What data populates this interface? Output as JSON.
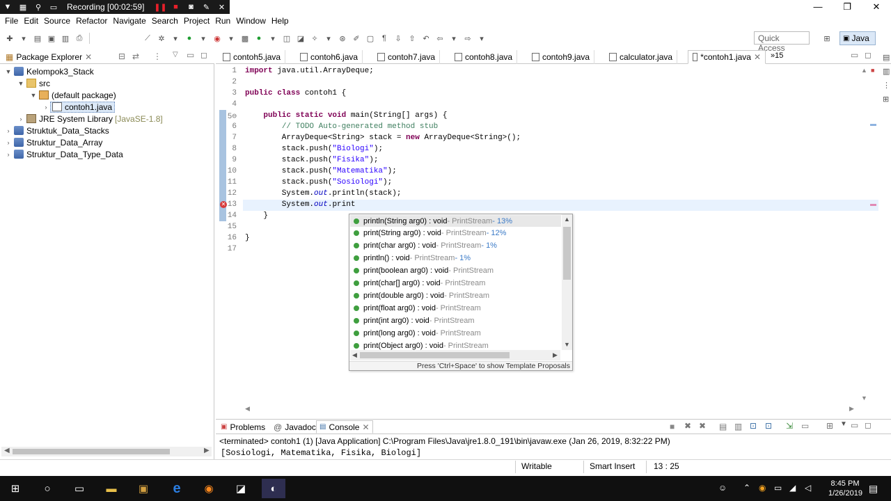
{
  "recording": {
    "label": "Recording [00:02:59]"
  },
  "window": {
    "minimize": "—",
    "maximize": "❐",
    "close": "✕"
  },
  "menu": [
    "File",
    "Edit",
    "Source",
    "Refactor",
    "Navigate",
    "Search",
    "Project",
    "Run",
    "Window",
    "Help"
  ],
  "toolbar": {
    "quick_access_placeholder": "Quick Access",
    "perspective": "Java"
  },
  "package_explorer": {
    "title": "Package Explorer",
    "tree": [
      {
        "label": "Kelompok3_Stack",
        "expanded": true
      },
      {
        "label": "src",
        "expanded": true
      },
      {
        "label": "(default package)",
        "expanded": true
      },
      {
        "label": "contoh1.java",
        "expanded": false
      },
      {
        "label": "JRE System Library",
        "suffix": "[JavaSE-1.8]",
        "expanded": false
      },
      {
        "label": "Struktuk_Data_Stacks",
        "expanded": false
      },
      {
        "label": "Struktur_Data_Array",
        "expanded": false
      },
      {
        "label": "Struktur_Data_Type_Data",
        "expanded": false
      }
    ]
  },
  "editor": {
    "tabs": [
      "contoh5.java",
      "contoh6.java",
      "contoh7.java",
      "contoh8.java",
      "contoh9.java",
      "calculator.java",
      "*contoh1.java"
    ],
    "overflow": "»15",
    "line_numbers": [
      "1",
      "2",
      "3",
      "4",
      "5⊖",
      "6",
      "7",
      "8",
      "9",
      "10",
      "11",
      "12",
      "13",
      "14",
      "15",
      "16",
      "17"
    ],
    "cursor": "13 : 25"
  },
  "content_assist": {
    "proposals": [
      {
        "sig": "println(String arg0) : void",
        "type": " - PrintStream",
        "pct": " - 13%"
      },
      {
        "sig": "print(String arg0) : void",
        "type": " - PrintStream",
        "pct": " - 12%"
      },
      {
        "sig": "print(char arg0) : void",
        "type": " - PrintStream",
        "pct": " - 1%"
      },
      {
        "sig": "println() : void",
        "type": " - PrintStream",
        "pct": " - 1%"
      },
      {
        "sig": "print(boolean arg0) : void",
        "type": " - PrintStream",
        "pct": ""
      },
      {
        "sig": "print(char[] arg0) : void",
        "type": " - PrintStream",
        "pct": ""
      },
      {
        "sig": "print(double arg0) : void",
        "type": " - PrintStream",
        "pct": ""
      },
      {
        "sig": "print(float arg0) : void",
        "type": " - PrintStream",
        "pct": ""
      },
      {
        "sig": "print(int arg0) : void",
        "type": " - PrintStream",
        "pct": ""
      },
      {
        "sig": "print(long arg0) : void",
        "type": " - PrintStream",
        "pct": ""
      },
      {
        "sig": "print(Object arg0) : void",
        "type": " - PrintStream",
        "pct": ""
      }
    ],
    "status": "Press 'Ctrl+Space' to show Template Proposals"
  },
  "bottom_panel": {
    "tabs": [
      "Problems",
      "Javadoc",
      "Console"
    ],
    "terminated": "<terminated> contoh1 (1) [Java Application] C:\\Program Files\\Java\\jre1.8.0_191\\bin\\javaw.exe (Jan 26, 2019, 8:32:22 PM)",
    "output": "[Sosiologi, Matematika, Fisika, Biologi]"
  },
  "status_bar": {
    "writable": "Writable",
    "insert_mode": "Smart Insert",
    "position": "13 : 25"
  },
  "taskbar": {
    "time": "8:45 PM",
    "date": "1/26/2019"
  }
}
